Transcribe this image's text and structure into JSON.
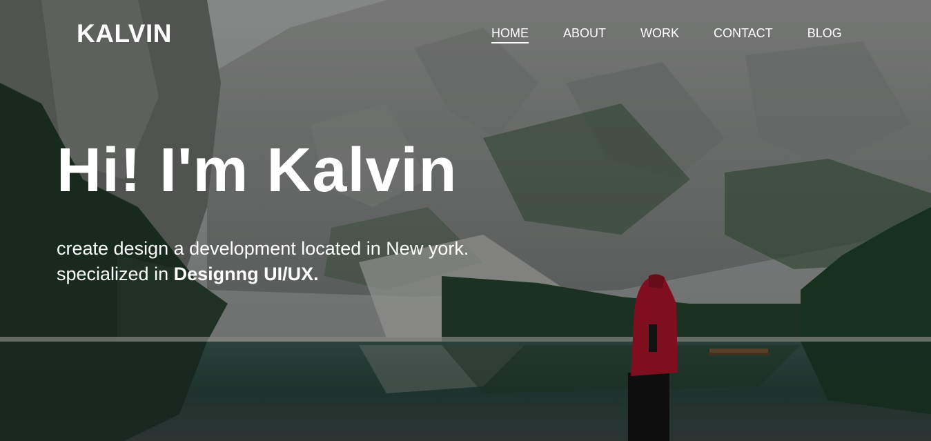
{
  "brand": {
    "logo_text": "KALVIN"
  },
  "nav": {
    "items": [
      {
        "label": "HOME",
        "active": true
      },
      {
        "label": "ABOUT",
        "active": false
      },
      {
        "label": "WORK",
        "active": false
      },
      {
        "label": "CONTACT",
        "active": false
      },
      {
        "label": "BLOG",
        "active": false
      }
    ]
  },
  "hero": {
    "headline": "Hi! I'm Kalvin",
    "tagline_line1": "create design a development located in New york.",
    "tagline_line2_prefix": "specialized in ",
    "tagline_line2_emphasis": "Designng UI/UX."
  },
  "colors": {
    "text": "#ffffff",
    "water": "#2f4a45",
    "forest": "#2d4a2f",
    "mountain": "#9a9d9c",
    "jacket": "#b0162a"
  }
}
